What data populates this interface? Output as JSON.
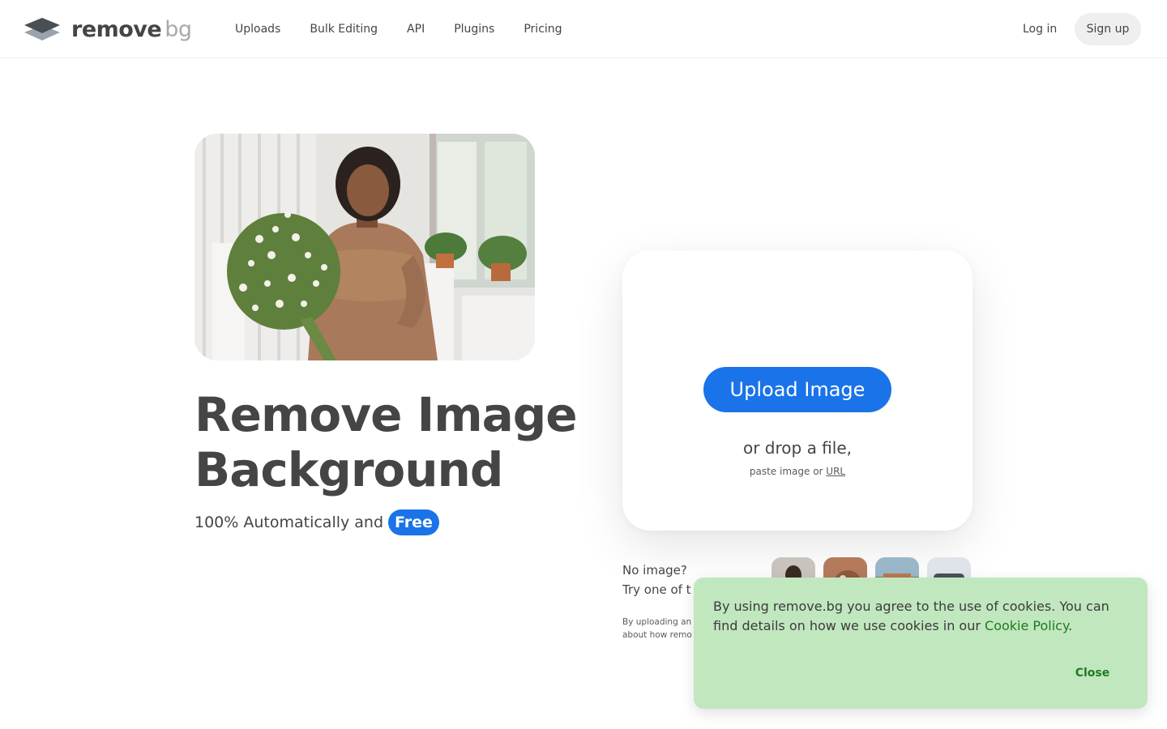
{
  "header": {
    "logo": {
      "word1": "remove",
      "word2": "bg"
    },
    "nav": [
      "Uploads",
      "Bulk Editing",
      "API",
      "Plugins",
      "Pricing"
    ],
    "login": "Log in",
    "signup": "Sign up"
  },
  "hero": {
    "title": "Remove Image Background",
    "subtitle_prefix": "100% Automatically and",
    "subtitle_badge": "Free"
  },
  "upload": {
    "button": "Upload Image",
    "drop": "or drop a file,",
    "paste_prefix": "paste image or",
    "paste_link": "URL"
  },
  "samples": {
    "line1": "No image?",
    "line2": "Try one of t",
    "legal1": "By uploading an",
    "legal2": "about how remo"
  },
  "cookie": {
    "text": "By using remove.bg you agree to the use of cookies. You can find details on how we use cookies in our",
    "link": "Cookie Policy",
    "period": ".",
    "close": "Close"
  },
  "colors": {
    "accent": "#1a73e8",
    "text": "#454545",
    "cookie_bg": "#c1e7bf",
    "cookie_link": "#1f7a1f"
  }
}
